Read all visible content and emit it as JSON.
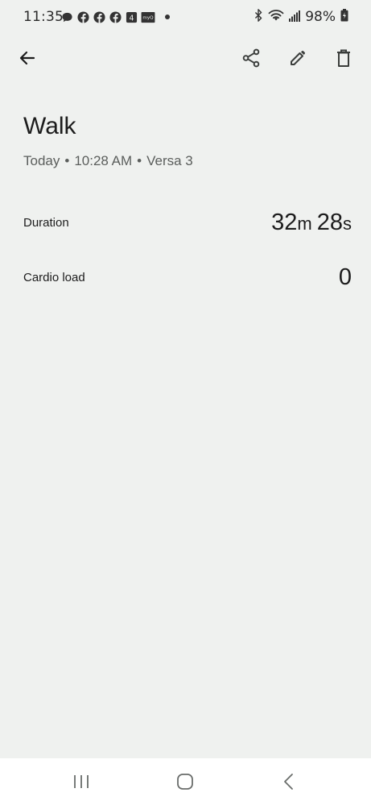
{
  "status_bar": {
    "time": "11:35",
    "battery": "98%",
    "notification_icons": [
      "chat-bubble-icon",
      "facebook-icon",
      "facebook-icon",
      "facebook-icon",
      "app-4-icon",
      "myq-icon",
      "more-dot-icon"
    ],
    "myq_label": "myQ",
    "app_4_label": "4"
  },
  "toolbar": {
    "back": "back-arrow-icon",
    "share": "share-icon",
    "edit": "pencil-icon",
    "delete": "trash-icon"
  },
  "activity": {
    "title": "Walk",
    "day": "Today",
    "time": "10:28 AM",
    "device": "Versa 3",
    "separator": "•"
  },
  "metrics": {
    "duration": {
      "label": "Duration",
      "minutes": "32",
      "minutes_unit": "m",
      "seconds": "28",
      "seconds_unit": "s"
    },
    "cardio_load": {
      "label": "Cardio load",
      "value": "0"
    }
  },
  "colors": {
    "background": "#eff1ef",
    "text_primary": "#1c1c1c",
    "text_secondary": "#5b5e5c",
    "nav_bar": "#ffffff"
  }
}
